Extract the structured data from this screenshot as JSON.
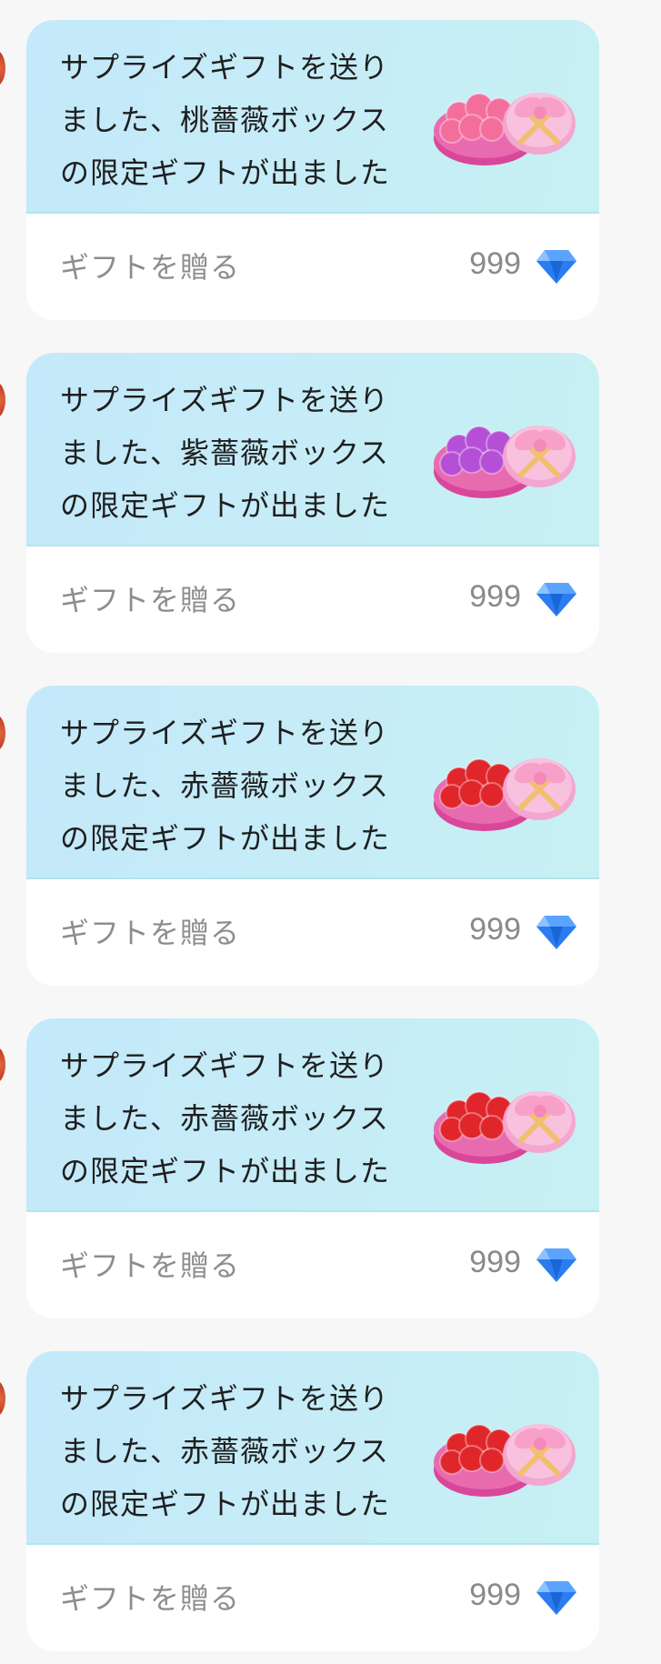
{
  "cards": [
    {
      "line1": "サプライズギフトを送り",
      "line2": "ました、桃薔薇ボックス",
      "line3": "の限定ギフトが出ました",
      "gift_icon": "pink-rose-gift-box-icon",
      "rose_color": "#f46e9c",
      "send_label": "ギフトを贈る",
      "price": "999",
      "currency_icon": "diamond-icon"
    },
    {
      "line1": "サプライズギフトを送り",
      "line2": "ました、紫薔薇ボックス",
      "line3": "の限定ギフトが出ました",
      "gift_icon": "purple-rose-gift-box-icon",
      "rose_color": "#b550d6",
      "send_label": "ギフトを贈る",
      "price": "999",
      "currency_icon": "diamond-icon"
    },
    {
      "line1": "サプライズギフトを送り",
      "line2": "ました、赤薔薇ボックス",
      "line3": "の限定ギフトが出ました",
      "gift_icon": "red-rose-gift-box-icon",
      "rose_color": "#e0262b",
      "send_label": "ギフトを贈る",
      "price": "999",
      "currency_icon": "diamond-icon"
    },
    {
      "line1": "サプライズギフトを送り",
      "line2": "ました、赤薔薇ボックス",
      "line3": "の限定ギフトが出ました",
      "gift_icon": "red-rose-gift-box-icon",
      "rose_color": "#e0262b",
      "send_label": "ギフトを贈る",
      "price": "999",
      "currency_icon": "diamond-icon"
    },
    {
      "line1": "サプライズギフトを送り",
      "line2": "ました、赤薔薇ボックス",
      "line3": "の限定ギフトが出ました",
      "gift_icon": "red-rose-gift-box-icon",
      "rose_color": "#e0262b",
      "send_label": "ギフトを贈る",
      "price": "999",
      "currency_icon": "diamond-icon"
    }
  ],
  "colors": {
    "card_top_start": "#c4e9fb",
    "card_top_end": "#c7f0f3",
    "diamond": "#2a7cf0",
    "box_pink": "#e04fa0"
  }
}
